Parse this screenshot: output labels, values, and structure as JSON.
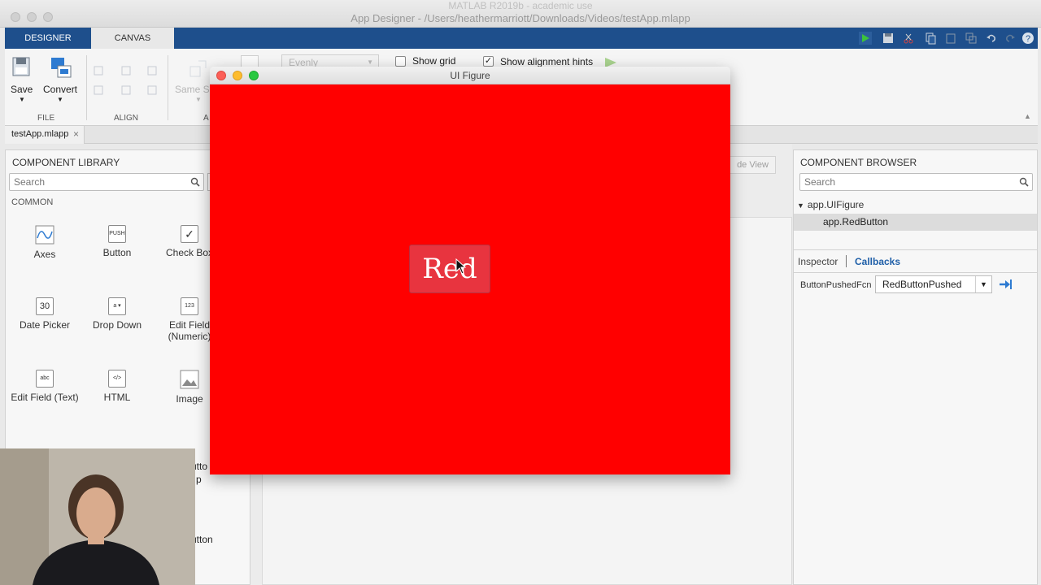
{
  "window": {
    "faint_title": "MATLAB R2019b - academic use",
    "title": "App Designer - /Users/heathermarriott/Downloads/Videos/testApp.mlapp"
  },
  "tabs": [
    {
      "label": "DESIGNER"
    },
    {
      "label": "CANVAS"
    }
  ],
  "toolstrip": {
    "save_label": "Save",
    "convert_label": "Convert",
    "file_section": "FILE",
    "align_section": "ALIGN",
    "same_size_label": "Same Si",
    "arrange_section_partial": "A",
    "evenly_label": "Evenly",
    "show_grid_label": "Show grid",
    "show_grid_checked": false,
    "show_alignment_label": "Show alignment hints",
    "show_alignment_checked": true
  },
  "file_tab": {
    "name": "testApp.mlapp",
    "close": "×"
  },
  "component_library": {
    "title": "COMPONENT LIBRARY",
    "search_placeholder": "Search",
    "section": "COMMON",
    "items": [
      {
        "label": "Axes",
        "icon": "axes-icon"
      },
      {
        "label": "Button",
        "icon": "push-button-icon",
        "glyph": "PUSH"
      },
      {
        "label": "Check Box",
        "icon": "check-box-icon",
        "glyph": "✓"
      },
      {
        "label": "Date Picker",
        "icon": "date-picker-icon",
        "glyph": "30"
      },
      {
        "label": "Drop Down",
        "icon": "drop-down-icon",
        "glyph": "a ▾"
      },
      {
        "label": "Edit Field (Numeric)",
        "icon": "numeric-field-icon",
        "glyph": "123"
      },
      {
        "label": "Edit Field (Text)",
        "icon": "text-field-icon",
        "glyph": "abc"
      },
      {
        "label": "HTML",
        "icon": "html-icon",
        "glyph": "</>"
      },
      {
        "label": "Image",
        "icon": "image-icon"
      }
    ],
    "partial_labels": [
      "utto",
      "p",
      "utton"
    ]
  },
  "canvas": {
    "hidden_button": "de View"
  },
  "ui_figure": {
    "title": "UI Figure",
    "background_color": "#ff0000",
    "button_label": "Red",
    "button_color": "#e8343f"
  },
  "component_browser": {
    "title": "COMPONENT BROWSER",
    "search_placeholder": "Search",
    "tree": [
      {
        "label": "app.UIFigure",
        "expanded": true
      },
      {
        "label": "app.RedButton",
        "selected": true
      }
    ],
    "inspector_tab": "Inspector",
    "callbacks_tab": "Callbacks",
    "callback_name": "ButtonPushedFcn",
    "callback_value": "RedButtonPushed"
  },
  "colors": {
    "toolstrip_blue": "#1e4f8c",
    "link_blue": "#1f5fa8"
  }
}
